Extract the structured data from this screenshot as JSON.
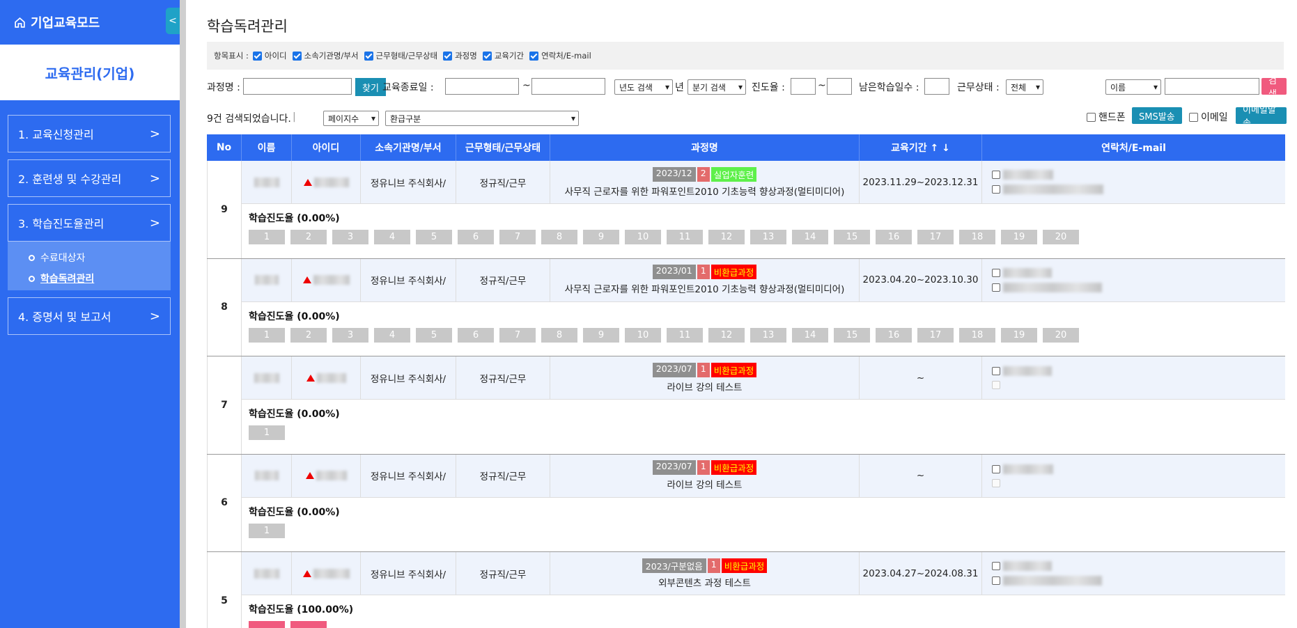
{
  "sidebar": {
    "brand": "기업교육모드",
    "toggle": "<",
    "section_title": "교육관리(기업)",
    "menus": [
      {
        "label": "1. 교육신청관리"
      },
      {
        "label": "2. 훈련생 및 수강관리"
      },
      {
        "label": "3. 학습진도율관리"
      },
      {
        "label": "4. 증명서 및 보고서"
      }
    ],
    "submenu": [
      {
        "label": "수료대상자",
        "active": false
      },
      {
        "label": "학습독려관리",
        "active": true
      }
    ],
    "chevron": ">"
  },
  "page": {
    "title": "학습독려관리"
  },
  "columns_bar": {
    "label": "항목표시 :",
    "items": [
      "아이디",
      "소속기관명/부서",
      "근무형태/근무상태",
      "과정명",
      "교육기간",
      "연락처/E-mail"
    ]
  },
  "search": {
    "course_label": "과정명 :",
    "find_button": "찾기",
    "end_date_label": "교육종료일 :",
    "tilde": "~",
    "year_select": "년도 검색",
    "year_unit": "년",
    "quarter_select": "분기 검색",
    "progress_label": "진도율 :",
    "remain_label": "남은학습일수 :",
    "work_status_label": "근무상태 :",
    "work_status_value": "전체",
    "field_select": "이름",
    "search_button": "검색"
  },
  "results": {
    "count_text": "9건 검색되었습니다.",
    "separator": "|",
    "page_select": "페이지수",
    "refund_select": "환급구분",
    "phone_label": "핸드폰",
    "sms_button": "SMS발송",
    "email_label": "이메일",
    "email_button": "이메일발송"
  },
  "table": {
    "headers": [
      "No",
      "이름",
      "아이디",
      "소속기관명/부서",
      "근무형태/근무상태",
      "과정명",
      "교육기간 ↑ ↓",
      "연락처/E-mail"
    ],
    "rows": [
      {
        "no": "9",
        "org": "정유니브 주식회사/",
        "work": "정규직/근무",
        "badge_period": "2023/12",
        "badge_num": "2",
        "badge_type": "실업자훈련",
        "course": "사무직 근로자를 위한 파워포인트2010 기초능력 향상과정(멀티미디어)",
        "period": "2023.11.29~2023.12.31",
        "progress": "학습진도율 (0.00%)",
        "boxes": [
          "1",
          "2",
          "3",
          "4",
          "5",
          "6",
          "7",
          "8",
          "9",
          "10",
          "11",
          "12",
          "13",
          "14",
          "15",
          "16",
          "17",
          "18",
          "19",
          "20"
        ],
        "done": 0
      },
      {
        "no": "8",
        "org": "정유니브 주식회사/",
        "work": "정규직/근무",
        "badge_period": "2023/01",
        "badge_num": "1",
        "badge_type": "비환급과정",
        "course": "사무직 근로자를 위한 파워포인트2010 기초능력 향상과정(멀티미디어)",
        "period": "2023.04.20~2023.10.30",
        "progress": "학습진도율 (0.00%)",
        "boxes": [
          "1",
          "2",
          "3",
          "4",
          "5",
          "6",
          "7",
          "8",
          "9",
          "10",
          "11",
          "12",
          "13",
          "14",
          "15",
          "16",
          "17",
          "18",
          "19",
          "20"
        ],
        "done": 0
      },
      {
        "no": "7",
        "org": "정유니브 주식회사/",
        "work": "정규직/근무",
        "badge_period": "2023/07",
        "badge_num": "1",
        "badge_type": "비환급과정",
        "course": "라이브 강의 테스트",
        "period": "~",
        "progress": "학습진도율 (0.00%)",
        "boxes": [
          "1"
        ],
        "done": 0
      },
      {
        "no": "6",
        "org": "정유니브 주식회사/",
        "work": "정규직/근무",
        "badge_period": "2023/07",
        "badge_num": "1",
        "badge_type": "비환급과정",
        "course": "라이브 강의 테스트",
        "period": "~",
        "progress": "학습진도율 (0.00%)",
        "boxes": [
          "1"
        ],
        "done": 0
      },
      {
        "no": "5",
        "org": "정유니브 주식회사/",
        "work": "정규직/근무",
        "badge_period": "2023/구분없음",
        "badge_num": "1",
        "badge_type": "비환급과정",
        "course": "외부콘텐츠 과정 테스트",
        "period": "2023.04.27~2024.08.31",
        "progress": "학습진도율 (100.00%)",
        "boxes": [
          "",
          ""
        ],
        "done": 2
      }
    ]
  }
}
